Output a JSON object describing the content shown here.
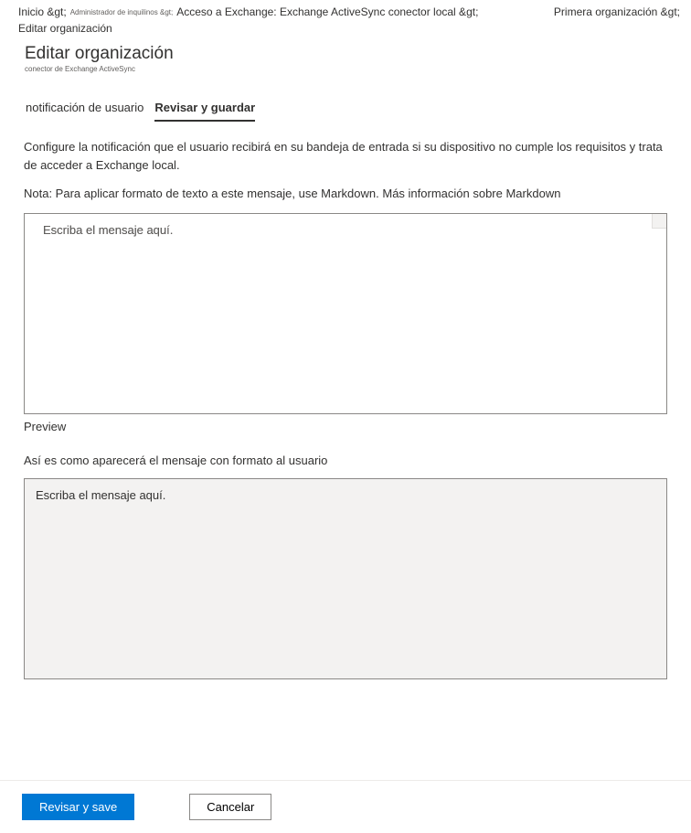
{
  "breadcrumb": {
    "items": [
      {
        "label": "Inicio &gt;",
        "small": false
      },
      {
        "label": "Administrador de inquilinos &gt;",
        "small": true
      },
      {
        "label": "Acceso a Exchange: Exchange ActiveSync conector local &gt;",
        "small": false
      },
      {
        "label": "Primera organización &gt;",
        "small": false
      },
      {
        "label": "Editar organización",
        "small": false
      }
    ]
  },
  "header": {
    "title": "Editar organización",
    "subtitle": "conector de Exchange ActiveSync"
  },
  "tabs": {
    "items": [
      {
        "label": "notificación de usuario",
        "active": false
      },
      {
        "label": "Revisar y guardar",
        "active": true
      }
    ]
  },
  "content": {
    "description": "Configure la notificación que el usuario recibirá en su bandeja de entrada si su dispositivo no cumple los requisitos y trata de acceder a Exchange local.",
    "note": "Nota: Para aplicar formato de texto a este mensaje, use Markdown. Más información sobre Markdown",
    "textarea_placeholder": "Escriba el mensaje aquí.",
    "preview_label": "Preview",
    "preview_desc": "Así es como aparecerá el mensaje con formato al usuario",
    "preview_content": "Escriba el mensaje aquí."
  },
  "footer": {
    "primary_label": "Revisar y save",
    "cancel_label": "Cancelar"
  }
}
